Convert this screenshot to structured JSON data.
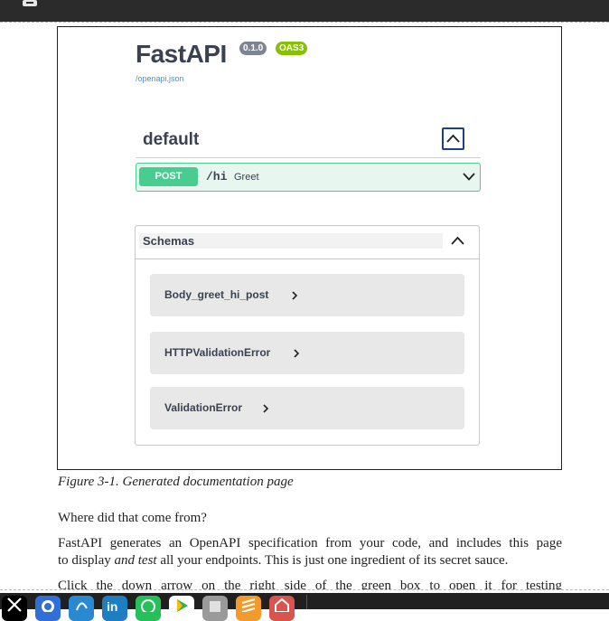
{
  "window": {
    "toolbar_icon": "printer-icon"
  },
  "swagger": {
    "title": "FastAPI",
    "version_badge": "0.1.0",
    "oas_badge": "OAS3",
    "openapi_link": "/openapi.json",
    "section_title": "default",
    "section_toggle_icon": "chevron-up-icon",
    "operation": {
      "method": "POST",
      "path": "/hi",
      "summary": "Greet",
      "expand_icon": "chevron-down-icon"
    },
    "schemas": {
      "title": "Schemas",
      "toggle_icon": "chevron-up-icon",
      "models": [
        {
          "label": "Body_greet_hi_post",
          "icon": "chevron-right-icon"
        },
        {
          "label": "HTTPValidationError",
          "icon": "chevron-right-icon"
        },
        {
          "label": "ValidationError",
          "icon": "chevron-right-icon"
        }
      ]
    }
  },
  "document": {
    "caption": "Figure 3-1. Generated documentation page",
    "paragraphs": [
      "Where did that come from?",
      "FastAPI generates an OpenAPI specification from your code, and includes this page",
      "to display ",
      "and test",
      " all your endpoints. This is just one ingredient of its secret sauce.",
      "Click the down arrow on the right side of the green box to open it for testing"
    ]
  },
  "taskbar": {
    "apps": [
      {
        "name": "x-icon",
        "color": "#000000"
      },
      {
        "name": "github-icon",
        "color": "#2f6fd6"
      },
      {
        "name": "bluesky-icon",
        "color": "#2a8ad1"
      },
      {
        "name": "linkedin-icon",
        "color": "#1d7ec1"
      },
      {
        "name": "whatsapp-icon",
        "color": "#25c05a"
      },
      {
        "name": "google-play-icon",
        "color": "#ffffff"
      },
      {
        "name": "script-editor-icon",
        "color": "#9a9a9a"
      },
      {
        "name": "sublime-text-icon",
        "color": "#f29b2c"
      },
      {
        "name": "app-icon",
        "color": "#d9534f"
      }
    ]
  },
  "colors": {
    "post_green": "#49cc90",
    "badge_gray": "#7d8492",
    "oas_green": "#89bf04",
    "link_blue": "#4990e2",
    "toggle_navy": "#1b3e8f"
  }
}
